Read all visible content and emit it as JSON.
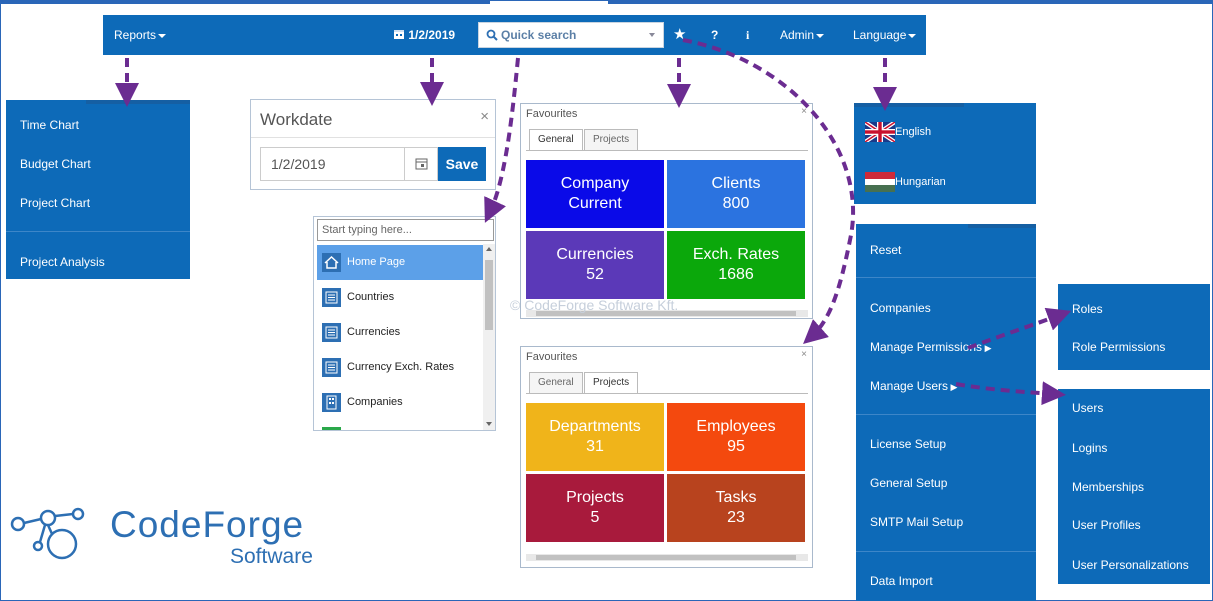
{
  "topbar": {
    "reports": "Reports",
    "date": "1/2/2019",
    "search_placeholder": "Quick search",
    "favourites_icon": "star-icon",
    "help": "?",
    "info": "i",
    "admin": "Admin",
    "language": "Language"
  },
  "reports_menu": {
    "items": [
      "Time Chart",
      "Budget Chart",
      "Project Chart",
      "Project Analysis"
    ]
  },
  "workdate": {
    "title": "Workdate",
    "value": "1/2/2019",
    "save_label": "Save",
    "close": "×"
  },
  "quick_search": {
    "placeholder": "Start typing here...",
    "items": [
      "Home Page",
      "Countries",
      "Currencies",
      "Currency Exch. Rates",
      "Companies"
    ]
  },
  "favourites_general": {
    "title": "Favourites",
    "close": "×",
    "tabs": [
      "General",
      "Projects"
    ],
    "active_tab": "General",
    "tiles": [
      {
        "label": "Company",
        "value": "Current",
        "color": "#0a0ae8"
      },
      {
        "label": "Clients",
        "value": "800",
        "color": "#2b73e0"
      },
      {
        "label": "Currencies",
        "value": "52",
        "color": "#5b39b8"
      },
      {
        "label": "Exch. Rates",
        "value": "1686",
        "color": "#0ba80b"
      }
    ]
  },
  "favourites_projects": {
    "title": "Favourites",
    "close": "×",
    "tabs": [
      "General",
      "Projects"
    ],
    "active_tab": "Projects",
    "tiles": [
      {
        "label": "Departments",
        "value": "31",
        "color": "#f0b41a"
      },
      {
        "label": "Employees",
        "value": "95",
        "color": "#f4490e"
      },
      {
        "label": "Projects",
        "value": "5",
        "color": "#a81a3c"
      },
      {
        "label": "Tasks",
        "value": "23",
        "color": "#b8431e"
      }
    ]
  },
  "watermark": "© CodeForge Software Kft.",
  "language_menu": {
    "items": [
      "English",
      "Hungarian"
    ]
  },
  "admin_menu": {
    "items": [
      "Reset",
      "Companies",
      "Manage Permissions",
      "Manage Users",
      "License Setup",
      "General Setup",
      "SMTP Mail Setup",
      "Data Import"
    ]
  },
  "permissions_menu": {
    "items": [
      "Roles",
      "Role Permissions"
    ]
  },
  "users_menu": {
    "items": [
      "Users",
      "Logins",
      "Memberships",
      "User Profiles",
      "User Personalizations"
    ]
  },
  "logo": {
    "name": "CodeForge",
    "sub": "Software"
  },
  "colors": {
    "primary": "#0d6ab8",
    "arrow": "#6b2c91"
  }
}
